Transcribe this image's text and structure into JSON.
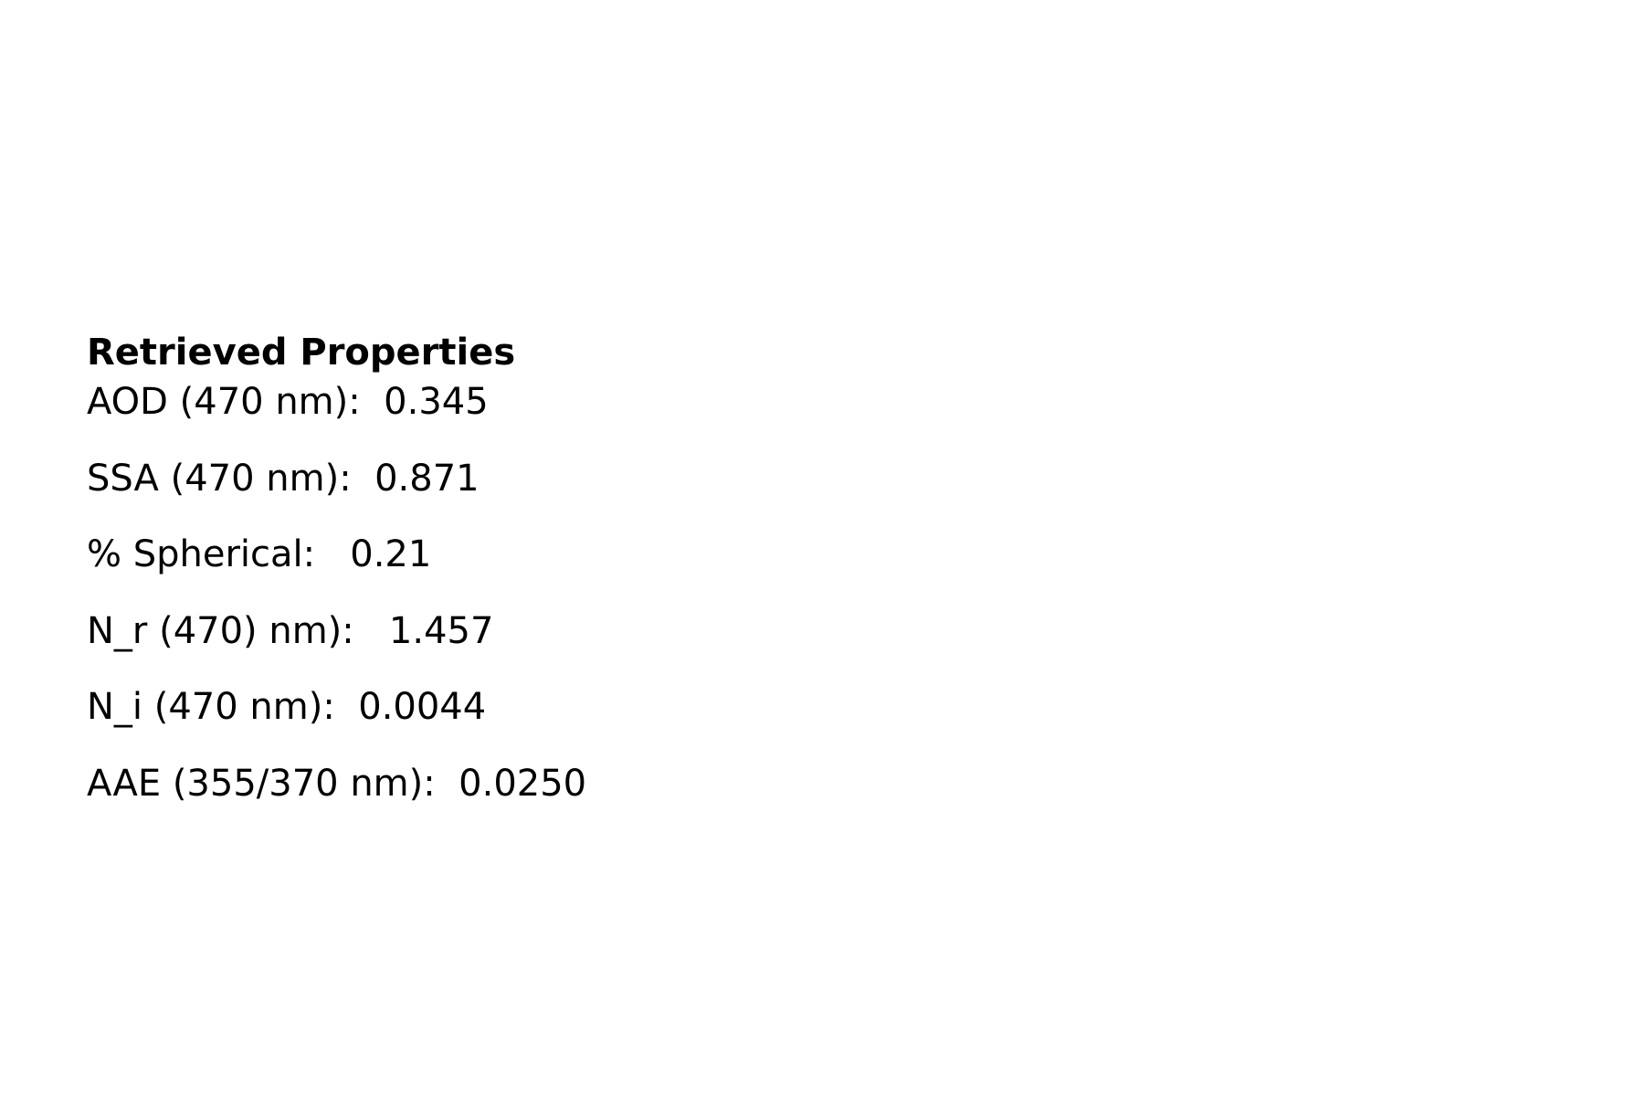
{
  "panel": {
    "title": "Retrieved Properties",
    "properties": [
      {
        "text": "AOD (470 nm):  0.345"
      },
      {
        "text": "SSA (470 nm):  0.871"
      },
      {
        "text": "% Spherical:   0.21"
      },
      {
        "text": "N_r (470) nm):   1.457"
      },
      {
        "text": "N_i (470 nm):  0.0044"
      },
      {
        "text": "AAE (355/370 nm):  0.0250"
      }
    ]
  }
}
